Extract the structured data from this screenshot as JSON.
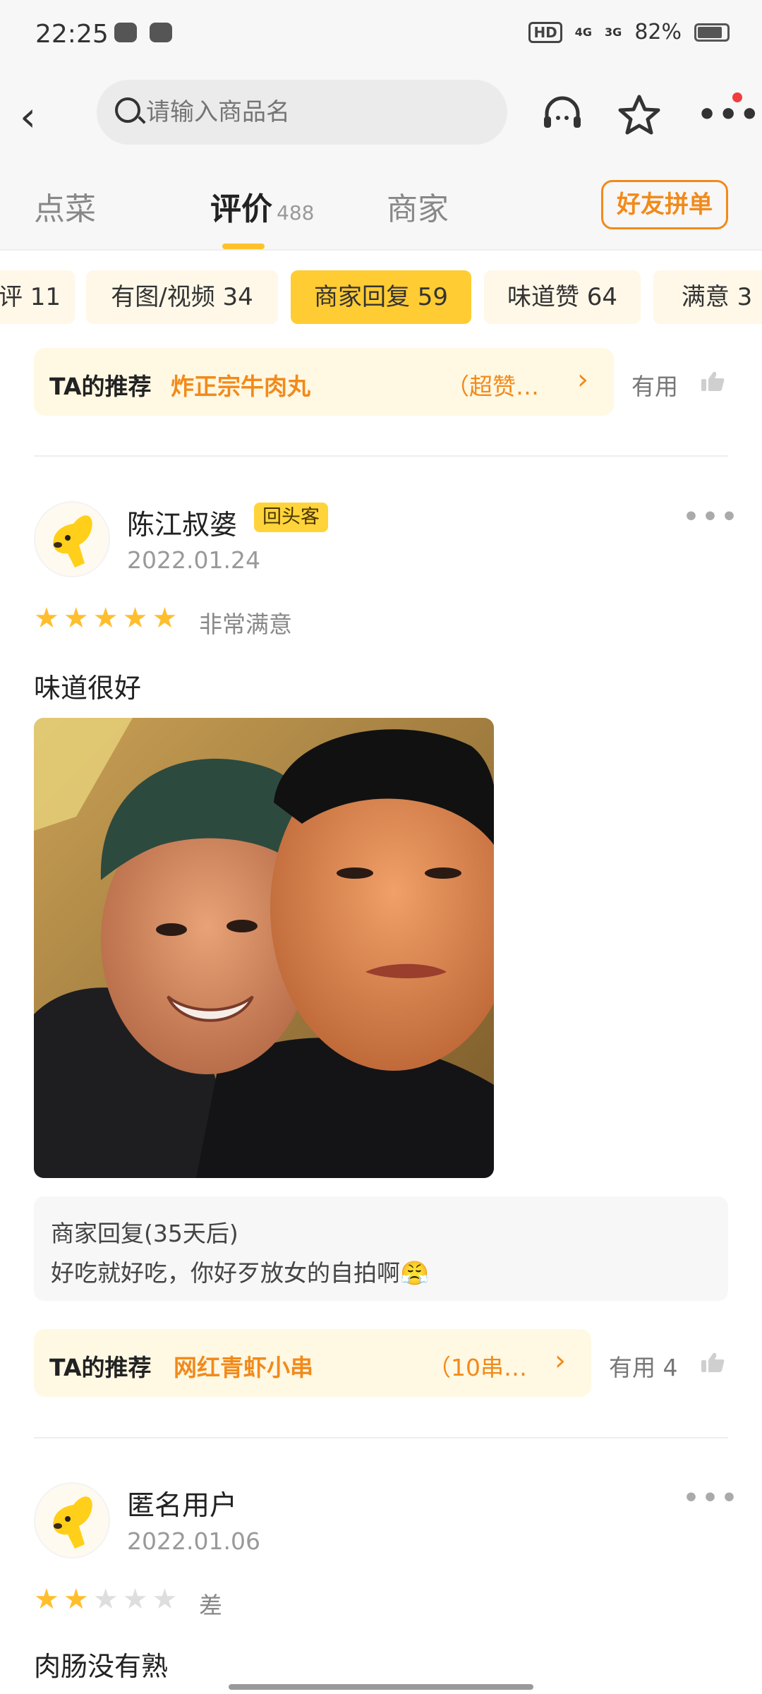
{
  "status_bar": {
    "time": "22:25",
    "hd": "HD",
    "net1": "4G",
    "net2": "3G",
    "battery": "82%"
  },
  "header": {
    "search_placeholder": "请输入商品名"
  },
  "tabs": [
    {
      "label": "点菜"
    },
    {
      "label": "评价",
      "count": "488"
    },
    {
      "label": "商家"
    }
  ],
  "friend_group_button": "好友拼单",
  "filters": [
    {
      "label": "评 11"
    },
    {
      "label": "有图/视频 34"
    },
    {
      "label": "商家回复 59",
      "selected": true
    },
    {
      "label": "味道赞 64"
    },
    {
      "label": "满意 3"
    }
  ],
  "top_recommend": {
    "label": "TA的推荐",
    "dish": "炸正宗牛肉丸",
    "note": "（超赞…",
    "useful": "有用"
  },
  "reviews": [
    {
      "user": "陈江叔婆",
      "badge": "回头客",
      "date": "2022.01.24",
      "stars": 5,
      "rating_text": "非常满意",
      "text": "味道很好",
      "merchant_reply_title": "商家回复(35天后)",
      "merchant_reply_text": "好吃就好吃，你好歹放女的自拍啊😤",
      "recommend": {
        "label": "TA的推荐",
        "dish": "网红青虾小串",
        "note": "（10串…",
        "useful": "有用 4"
      }
    },
    {
      "user": "匿名用户",
      "date": "2022.01.06",
      "stars": 2,
      "rating_text": "差",
      "text": "肉肠没有熟"
    }
  ],
  "colors": {
    "accent": "#ffcc33",
    "orange": "#f28a1a",
    "star": "#ffbe2e"
  }
}
